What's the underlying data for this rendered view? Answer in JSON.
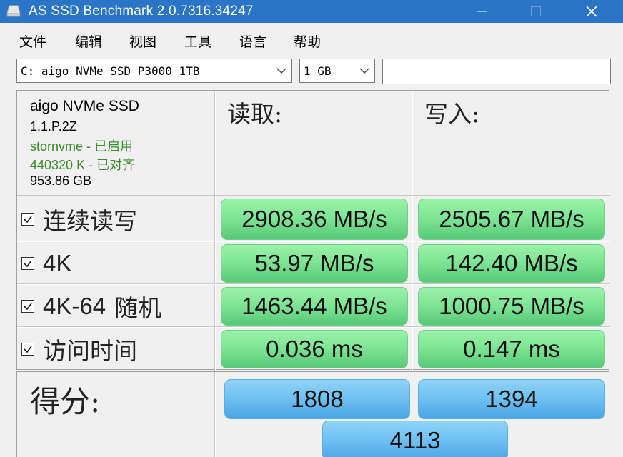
{
  "window": {
    "title": "AS SSD Benchmark 2.0.7316.34247"
  },
  "menu": [
    "文件",
    "编辑",
    "视图",
    "工具",
    "语言",
    "帮助"
  ],
  "toolbar": {
    "drive_value": "C: aigo NVMe SSD P3000 1TB",
    "size_value": "1 GB",
    "text_value": ""
  },
  "drive_info": {
    "name": "aigo NVMe SSD",
    "firmware": "1.1.P.2Z",
    "driver": "stornvme - 已启用",
    "alignment": "440320 K - 已对齐",
    "capacity": "953.86 GB"
  },
  "columns": {
    "read": "读取:",
    "write": "写入:"
  },
  "tests": [
    {
      "label": "连续读写",
      "read": "2908.36 MB/s",
      "write": "2505.67 MB/s",
      "checked": true
    },
    {
      "label": "4K",
      "read": "53.97 MB/s",
      "write": "142.40 MB/s",
      "checked": true
    },
    {
      "label_latin": "4K-64",
      "label": "随机",
      "read": "1463.44 MB/s",
      "write": "1000.75 MB/s",
      "checked": true
    },
    {
      "label": "访问时间",
      "read": "0.036 ms",
      "write": "0.147 ms",
      "checked": true
    }
  ],
  "score": {
    "label": "得分:",
    "read": "1808",
    "write": "1394",
    "total": "4113"
  },
  "colors": {
    "titlebar": "#2b75c6",
    "result_green": "#7de394",
    "score_blue": "#6ec0f1",
    "driver_text": "#3d8a2e"
  }
}
